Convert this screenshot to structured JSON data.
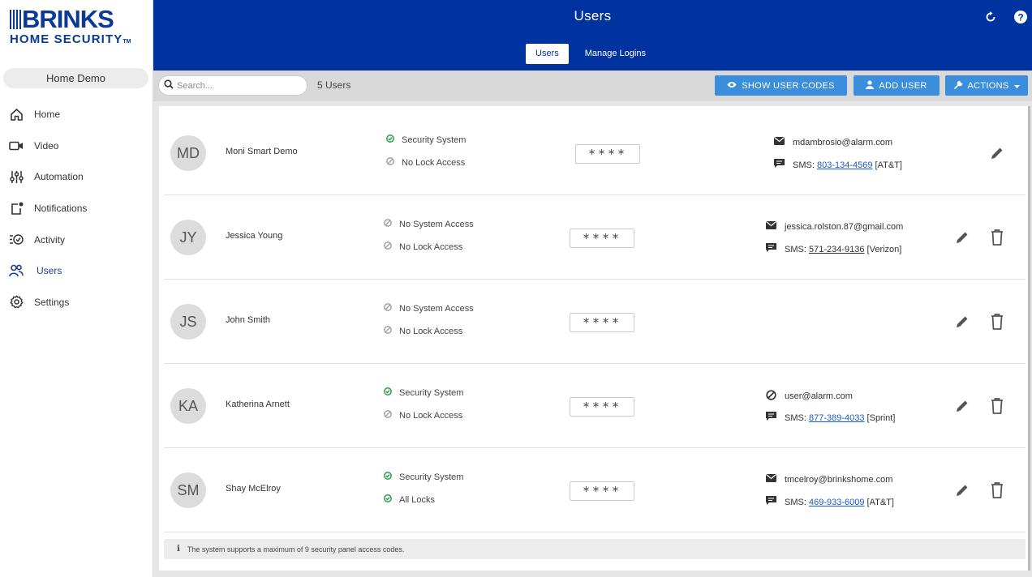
{
  "brand": {
    "name": "BRINKS",
    "sub": "HOME SECURITY",
    "tm": "TM"
  },
  "site": "Home Demo",
  "nav": [
    {
      "label": "Home",
      "icon": "house-icon"
    },
    {
      "label": "Video",
      "icon": "video-camera-icon"
    },
    {
      "label": "Automation",
      "icon": "sliders-icon"
    },
    {
      "label": "Notifications",
      "icon": "notification-icon"
    },
    {
      "label": "Activity",
      "icon": "activity-list-icon"
    },
    {
      "label": "Users",
      "icon": "users-icon",
      "active": true
    },
    {
      "label": "Settings",
      "icon": "gear-icon"
    }
  ],
  "header": {
    "title": "Users",
    "tabs": [
      "Users",
      "Manage Logins"
    ]
  },
  "toolbar": {
    "search_placeholder": "Search...",
    "count": "5 Users",
    "show_codes": "SHOW USER CODES",
    "add_user": "ADD USER",
    "actions": "ACTIONS"
  },
  "users": [
    {
      "initials": "MD",
      "name": "Moni Smart Demo",
      "access": [
        {
          "label": "Security System",
          "enabled": true
        },
        {
          "label": "No Lock Access",
          "enabled": false
        }
      ],
      "code": "****",
      "email": "mdambrosio@alarm.com",
      "email_enabled": true,
      "sms_label": "SMS:",
      "phone": "803-134-4569",
      "carrier": "[AT&T]",
      "deletable": false
    },
    {
      "initials": "JY",
      "name": "Jessica Young",
      "access": [
        {
          "label": "No System Access",
          "enabled": false
        },
        {
          "label": "No Lock Access",
          "enabled": false
        }
      ],
      "code": "****",
      "email": "jessica.rolston.87@gmail.com",
      "email_enabled": true,
      "sms_label": "SMS:",
      "phone": "571-234-9136",
      "carrier": "[Verizon]",
      "deletable": true
    },
    {
      "initials": "JS",
      "name": "John Smith",
      "access": [
        {
          "label": "No System Access",
          "enabled": false
        },
        {
          "label": "No Lock Access",
          "enabled": false
        }
      ],
      "code": "****",
      "deletable": true
    },
    {
      "initials": "KA",
      "name": "Katherina Arnett",
      "access": [
        {
          "label": "Security System",
          "enabled": true
        },
        {
          "label": "No Lock Access",
          "enabled": false
        }
      ],
      "code": "****",
      "email": "user@alarm.com",
      "email_enabled": false,
      "sms_label": "SMS:",
      "phone": "877-389-4033",
      "carrier": "[Sprint]",
      "deletable": true
    },
    {
      "initials": "SM",
      "name": "Shay McElroy",
      "access": [
        {
          "label": "Security System",
          "enabled": true
        },
        {
          "label": "All Locks",
          "enabled": true
        }
      ],
      "code": "****",
      "email": "tmcelroy@brinkshome.com",
      "email_enabled": true,
      "sms_label": "SMS:",
      "phone": "469-933-6009",
      "carrier": "[AT&T]",
      "deletable": true
    }
  ],
  "notice": "The system supports a maximum of 9 security panel access codes.",
  "colors": {
    "header": "#0033a0",
    "button": "#3a8edb",
    "enabled": "#2e9b4a",
    "link": "#1a5bc4"
  }
}
